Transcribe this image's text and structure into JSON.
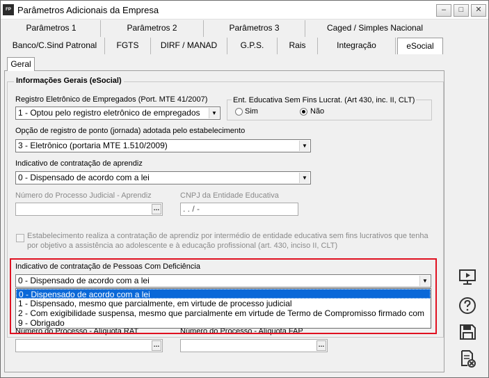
{
  "window": {
    "app_icon": "FP",
    "title": "Parâmetros Adicionais da Empresa",
    "min": "‒",
    "max": "□",
    "close": "✕"
  },
  "tabs_row1": [
    "Parâmetros 1",
    "Parâmetros 2",
    "Parâmetros 3",
    "Caged / Simples Nacional"
  ],
  "tabs_row2": [
    "Banco/C.Sind Patronal",
    "FGTS",
    "DIRF / MANAD",
    "G.P.S.",
    "Rais",
    "Integração",
    "eSocial"
  ],
  "subtab": "Geral",
  "group_title": "Informações Gerais (eSocial)",
  "registro": {
    "label": "Registro Eletrônico de Empregados (Port. MTE 41/2007)",
    "value": "1 - Optou pelo registro eletrônico de empregados"
  },
  "ent_educativa": {
    "label": "Ent. Educativa Sem Fins Lucrat. (Art 430, inc. II, CLT)",
    "sim": "Sim",
    "nao": "Não",
    "selected": "Não"
  },
  "ponto": {
    "label": "Opção de registro de ponto (jornada) adotada pelo estabelecimento",
    "value": "3 - Eletrônico (portaria MTE 1.510/2009)"
  },
  "aprendiz": {
    "label": "Indicativo de contratação de aprendiz",
    "value": "0 - Dispensado de acordo com a lei"
  },
  "processo_aprendiz": {
    "label": "Número do Processo Judicial - Aprendiz",
    "value": ""
  },
  "cnpj_entidade": {
    "label": "CNPJ da Entidade Educativa",
    "value": ". . / -"
  },
  "checkbox_text": {
    "line1": "Estabelecimento realiza a contratação de aprendiz por intermédio de entidade educativa sem fins lucrativos que tenha",
    "line2": "por objetivo a assistência ao adolescente e à educação profissional (art. 430, inciso II, CLT)"
  },
  "pcd": {
    "label": "Indicativo de contratação de Pessoas Com Deficiência",
    "value": "0 - Dispensado de acordo com a lei",
    "options": [
      "0 - Dispensado de acordo com a lei",
      "1 - Dispensado, mesmo que parcialmente, em virtude de processo judicial",
      "2 - Com exigibilidade suspensa, mesmo que parcialmente em virtude de Termo de Compromisso firmado com",
      "9 - Obrigado"
    ]
  },
  "proc_rat": {
    "label": "Número do Processo - Alíquota RAT"
  },
  "proc_fap": {
    "label": "Número do Processo - Alíquota FAP"
  },
  "side_icons": [
    "presentation-icon",
    "help-icon",
    "save-icon",
    "cancel-document-icon"
  ],
  "colors": {
    "accent": "#0a68d8",
    "highlight_border": "#e01020"
  }
}
